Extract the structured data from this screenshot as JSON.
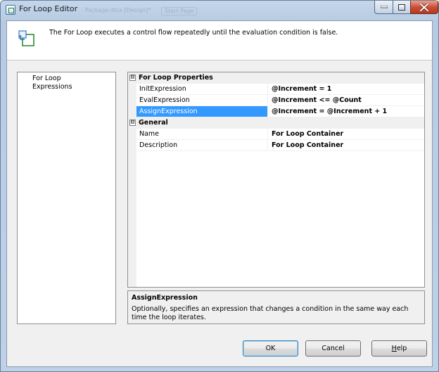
{
  "window": {
    "title": "For Loop Editor",
    "background_tabs": [
      "Package.dtsx [Design]*",
      "Start Page"
    ]
  },
  "header": {
    "description": "The For Loop executes a control flow repeatedly until the evaluation condition is false."
  },
  "nav": {
    "items": [
      {
        "label": "For Loop"
      },
      {
        "label": "Expressions"
      }
    ]
  },
  "grid": {
    "categories": [
      {
        "label": "For Loop Properties",
        "expander": "⊟",
        "properties": [
          {
            "name": "InitExpression",
            "value": "@Increment = 1"
          },
          {
            "name": "EvalExpression",
            "value": "@Increment <= @Count"
          },
          {
            "name": "AssignExpression",
            "value": "@Increment = @Increment + 1"
          }
        ]
      },
      {
        "label": "General",
        "expander": "⊟",
        "properties": [
          {
            "name": "Name",
            "value": "For Loop Container"
          },
          {
            "name": "Description",
            "value": "For Loop Container"
          }
        ]
      }
    ],
    "selected_property": "AssignExpression"
  },
  "description_panel": {
    "title": "AssignExpression",
    "body": "Optionally, specifies an expression that changes a condition in the same way each time the loop iterates."
  },
  "buttons": {
    "ok": "OK",
    "cancel": "Cancel",
    "help": "Help"
  },
  "icons": {
    "title": "for-loop-icon",
    "header": "for-loop-container-icon",
    "minimize": "minimize-icon",
    "maximize": "maximize-icon",
    "close": "close-icon"
  },
  "colors": {
    "selection": "#3399ff",
    "close_button": "#c94b33",
    "dialog_face": "#f0f0f0"
  }
}
